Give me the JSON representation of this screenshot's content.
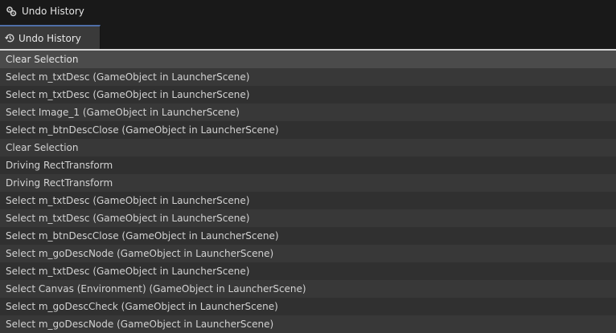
{
  "window": {
    "title": "Undo History",
    "icon": "unity-logo-icon"
  },
  "tab": {
    "label": "Undo History",
    "icon": "history-icon"
  },
  "history": [
    "Clear Selection",
    "Select m_txtDesc (GameObject in LauncherScene)",
    "Select m_txtDesc (GameObject in LauncherScene)",
    "Select Image_1 (GameObject in LauncherScene)",
    "Select m_btnDescClose (GameObject in LauncherScene)",
    "Clear Selection",
    "Driving RectTransform",
    "Driving RectTransform",
    "Select m_txtDesc (GameObject in LauncherScene)",
    "Select m_txtDesc (GameObject in LauncherScene)",
    "Select m_btnDescClose (GameObject in LauncherScene)",
    "Select m_goDescNode (GameObject in LauncherScene)",
    "Select m_txtDesc (GameObject in LauncherScene)",
    "Select Canvas (Environment) (GameObject in LauncherScene)",
    "Select m_goDescCheck (GameObject in LauncherScene)",
    "Select m_goDescNode (GameObject in LauncherScene)"
  ],
  "colors": {
    "titlebar": "#191919",
    "tab_active": "#3a3a3a",
    "tab_accent": "#4f6ea8",
    "row_even": "#383838",
    "row_odd": "#303030",
    "row_highlight": "#4b4b4b"
  }
}
